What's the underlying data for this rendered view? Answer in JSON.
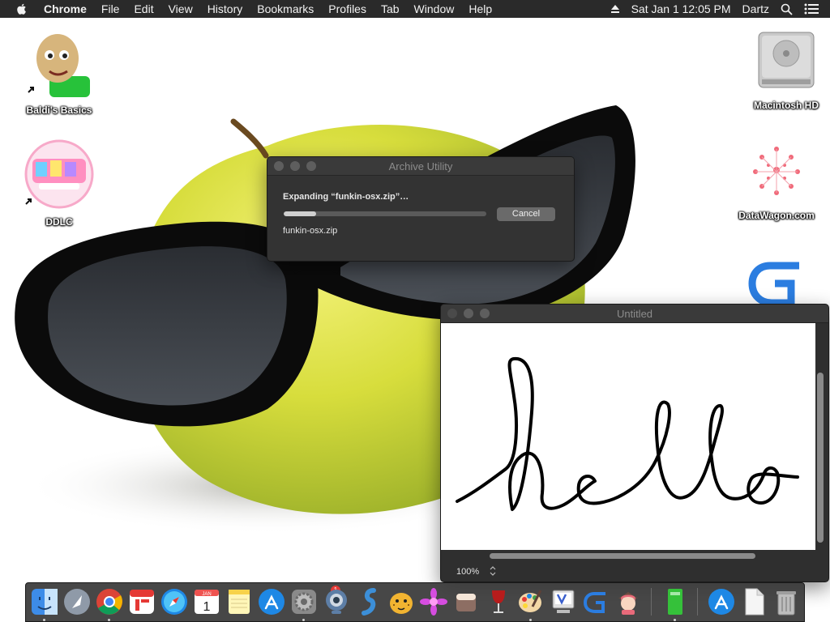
{
  "menubar": {
    "items": [
      "Chrome",
      "File",
      "Edit",
      "View",
      "History",
      "Bookmarks",
      "Profiles",
      "Tab",
      "Window",
      "Help"
    ],
    "clock": "Sat Jan 1  12:05 PM",
    "user": "Dartz"
  },
  "desktop": {
    "icons": [
      {
        "label": "Baldi's Basics",
        "icon": "baldi-icon"
      },
      {
        "label": "DDLC",
        "icon": "ddlc-icon"
      },
      {
        "label": "Macintosh HD",
        "icon": "hard-drive-icon"
      },
      {
        "label": "DataWagon.com",
        "icon": "datawagon-icon"
      },
      {
        "label": "",
        "icon": "gdevelop-icon"
      }
    ]
  },
  "archive_utility": {
    "title": "Archive Utility",
    "message": "Expanding “funkin-osx.zip”…",
    "progress": 0.16,
    "cancel_label": "Cancel",
    "filename": "funkin-osx.zip"
  },
  "paint_window": {
    "title": "Untitled",
    "canvas_text": "hello",
    "zoom": "100%"
  },
  "dock": {
    "apps": [
      "finder-icon",
      "launchpad-icon",
      "chrome-icon",
      "fantastical-icon",
      "safari-icon",
      "calendar-icon",
      "notes-icon",
      "app-store-icon",
      "system-preferences-icon",
      "webcam-icon",
      "squiggle-app-icon",
      "cheetah-app-icon",
      "flower-app-icon",
      "cube-app-icon",
      "wine-icon",
      "paintbrush-icon",
      "vnc-icon",
      "gdevelop-icon",
      "character-app-icon",
      "terminal-app-icon",
      "app-store-icon",
      "document-icon",
      "trash-icon"
    ],
    "calendar_month": "JAN",
    "calendar_day": "1",
    "badge": "1"
  }
}
